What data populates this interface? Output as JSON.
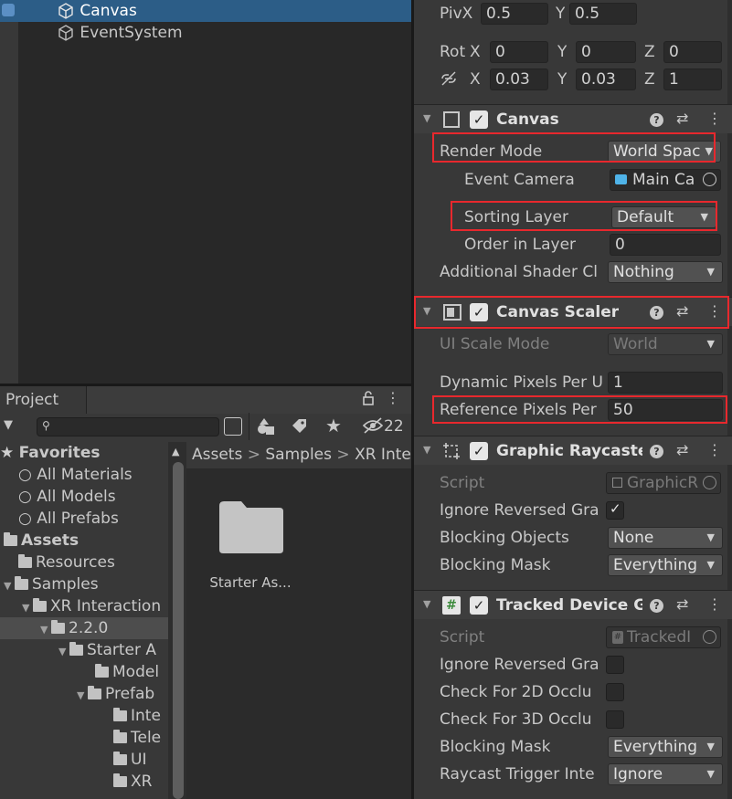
{
  "hierarchy": {
    "items": [
      {
        "label": "Canvas"
      },
      {
        "label": "EventSystem"
      }
    ]
  },
  "project": {
    "tab_label": "Project",
    "hidden_count": "22",
    "tree": {
      "favorites": "Favorites",
      "fav_items": [
        "All Materials",
        "All Models",
        "All Prefabs"
      ],
      "assets": "Assets",
      "resources": "Resources",
      "samples": "Samples",
      "xri": "XR Interaction",
      "version": "2.2.0",
      "starter": "Starter A",
      "models": "Model",
      "prefabs": "Prefab",
      "inter": "Inte",
      "tele": "Tele",
      "ui": "UI",
      "xr": "XR"
    },
    "breadcrumb": [
      "Assets",
      "Samples",
      "XR Inte"
    ],
    "folder_label": "Starter As..."
  },
  "inspector": {
    "pivot": {
      "label": "Piv",
      "x_label": "X",
      "x": "0.5",
      "y_label": "Y",
      "y": "0.5"
    },
    "rotation": {
      "label": "Rot",
      "x_label": "X",
      "x": "0",
      "y_label": "Y",
      "y": "0",
      "z_label": "Z",
      "z": "0"
    },
    "scale": {
      "x_label": "X",
      "x": "0.03",
      "y_label": "Y",
      "y": "0.03",
      "z_label": "Z",
      "z": "1"
    },
    "canvas": {
      "title": "Canvas",
      "render_mode_label": "Render Mode",
      "render_mode": "World Spac",
      "event_camera_label": "Event Camera",
      "event_camera": "Main Ca",
      "sorting_layer_label": "Sorting Layer",
      "sorting_layer": "Default",
      "order_label": "Order in Layer",
      "order": "0",
      "shader_label": "Additional Shader Cl",
      "shader": "Nothing"
    },
    "scaler": {
      "title": "Canvas Scaler",
      "scale_mode_label": "UI Scale Mode",
      "scale_mode": "World",
      "dynamic_label": "Dynamic Pixels Per U",
      "dynamic": "1",
      "reference_label": "Reference Pixels Per",
      "reference": "50"
    },
    "raycaster": {
      "title": "Graphic Raycaste",
      "script_label": "Script",
      "script": "GraphicR",
      "ignore_label": "Ignore Reversed Gra",
      "blocking_objects_label": "Blocking Objects",
      "blocking_objects": "None",
      "blocking_mask_label": "Blocking Mask",
      "blocking_mask": "Everything"
    },
    "tracked": {
      "title": "Tracked Device G",
      "script_label": "Script",
      "script": "TrackedI",
      "ignore_label": "Ignore Reversed Gra",
      "check2d_label": "Check For 2D Occlu",
      "check3d_label": "Check For 3D Occlu",
      "blocking_mask_label": "Blocking Mask",
      "blocking_mask": "Everything",
      "raycast_label": "Raycast Trigger Inte",
      "raycast": "Ignore"
    }
  },
  "colors": {
    "highlight": "#e8282d",
    "selection": "#2c5d87"
  }
}
